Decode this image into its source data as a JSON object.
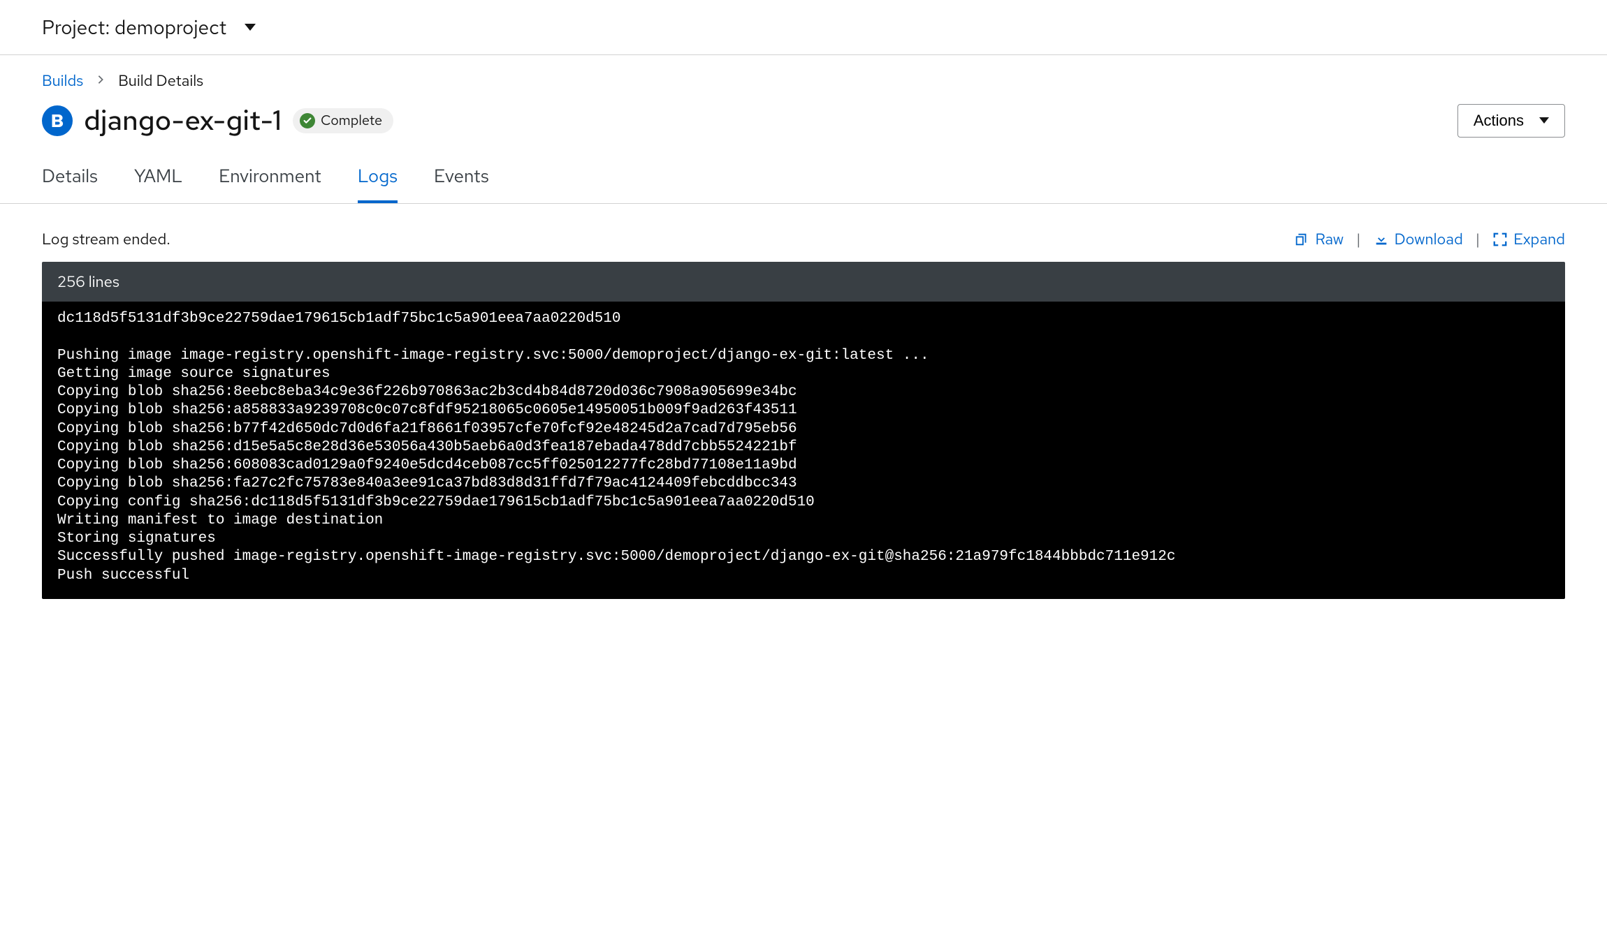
{
  "project": {
    "label": "Project: demoproject"
  },
  "breadcrumb": {
    "root": "Builds",
    "current": "Build Details"
  },
  "title": {
    "badge_letter": "B",
    "name": "django-ex-git-1",
    "status": "Complete"
  },
  "actions": {
    "label": "Actions"
  },
  "tabs": [
    {
      "label": "Details",
      "active": false
    },
    {
      "label": "YAML",
      "active": false
    },
    {
      "label": "Environment",
      "active": false
    },
    {
      "label": "Logs",
      "active": true
    },
    {
      "label": "Events",
      "active": false
    }
  ],
  "log": {
    "status_text": "Log stream ended.",
    "raw_label": "Raw",
    "download_label": "Download",
    "expand_label": "Expand",
    "line_count": "256 lines",
    "content": "dc118d5f5131df3b9ce22759dae179615cb1adf75bc1c5a901eea7aa0220d510\n\nPushing image image-registry.openshift-image-registry.svc:5000/demoproject/django-ex-git:latest ...\nGetting image source signatures\nCopying blob sha256:8eebc8eba34c9e36f226b970863ac2b3cd4b84d8720d036c7908a905699e34bc\nCopying blob sha256:a858833a9239708c0c07c8fdf95218065c0605e14950051b009f9ad263f43511\nCopying blob sha256:b77f42d650dc7d0d6fa21f8661f03957cfe70fcf92e48245d2a7cad7d795eb56\nCopying blob sha256:d15e5a5c8e28d36e53056a430b5aeb6a0d3fea187ebada478dd7cbb5524221bf\nCopying blob sha256:608083cad0129a0f9240e5dcd4ceb087cc5ff025012277fc28bd77108e11a9bd\nCopying blob sha256:fa27c2fc75783e840a3ee91ca37bd83d8d31ffd7f79ac4124409febcddbcc343\nCopying config sha256:dc118d5f5131df3b9ce22759dae179615cb1adf75bc1c5a901eea7aa0220d510\nWriting manifest to image destination\nStoring signatures\nSuccessfully pushed image-registry.openshift-image-registry.svc:5000/demoproject/django-ex-git@sha256:21a979fc1844bbbdc711e912c\nPush successful"
  }
}
